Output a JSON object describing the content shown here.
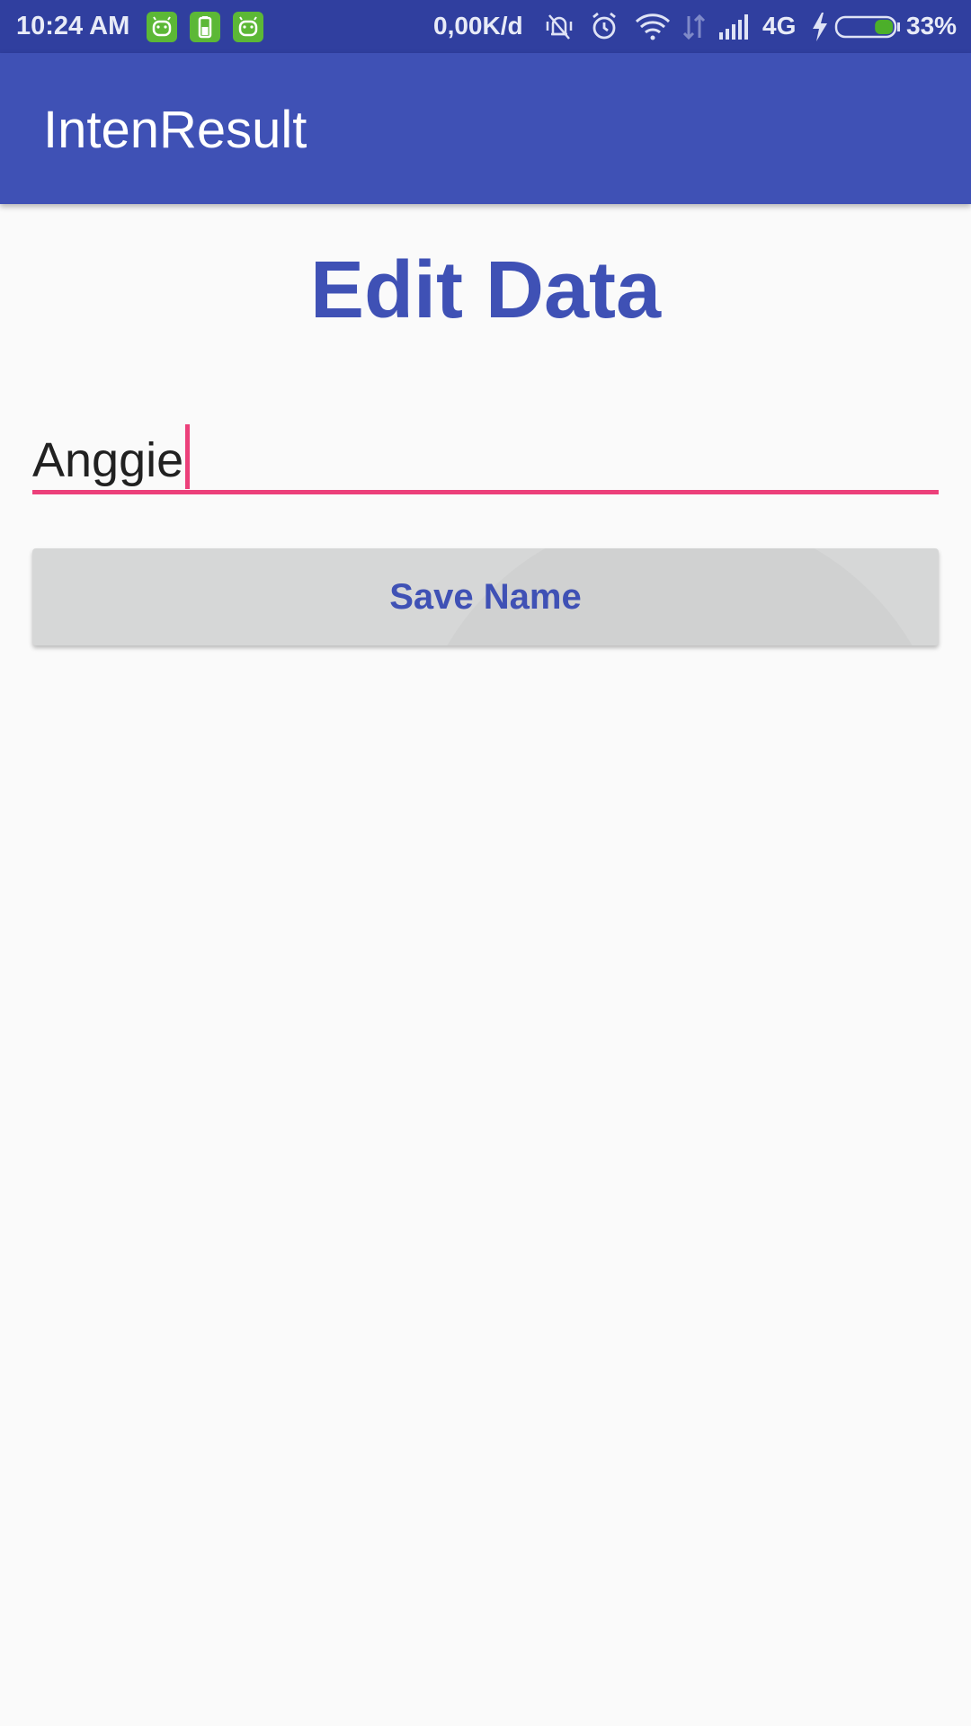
{
  "status_bar": {
    "time": "10:24 AM",
    "net_speed": "0,00K/d",
    "network_type": "4G",
    "battery_percent": "33%",
    "battery_level": 0.33,
    "notification_icons": [
      "android-app-icon",
      "battery-app-icon",
      "android-app-icon"
    ],
    "status_icons": [
      "vibrate-off-icon",
      "alarm-icon",
      "wifi-icon",
      "data-arrows-icon",
      "signal-icon",
      "charging-icon",
      "battery-icon"
    ]
  },
  "app_bar": {
    "title": "IntenResult"
  },
  "main": {
    "heading": "Edit Data",
    "name_input": {
      "value": "Anggie"
    },
    "save_button_label": "Save Name"
  },
  "colors": {
    "primary": "#3f51b5",
    "primary_dark": "#303f9f",
    "accent": "#ec407a",
    "background": "#fafafa",
    "button": "#d6d7d7"
  }
}
